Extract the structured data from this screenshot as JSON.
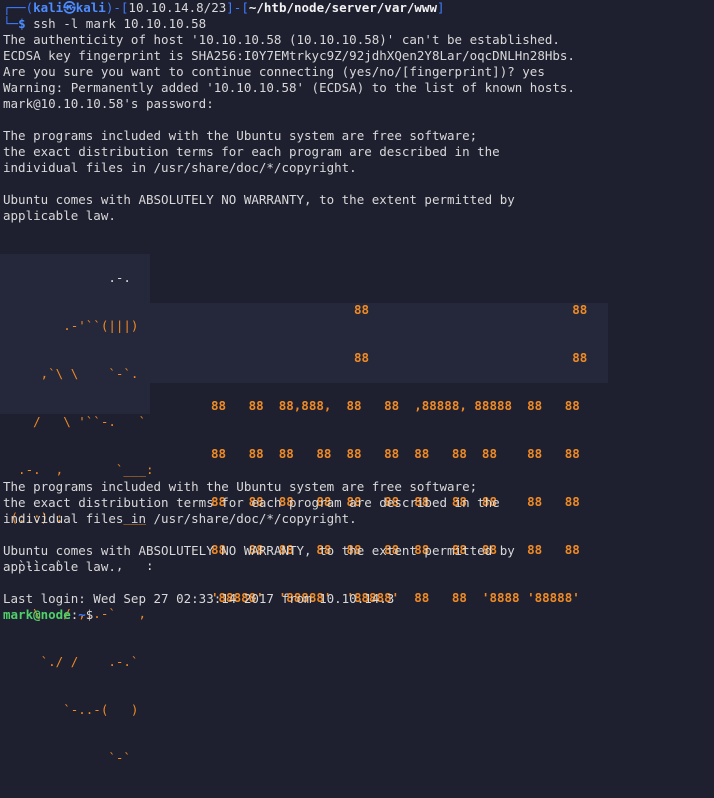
{
  "prompt": {
    "corner_top": "┌──(",
    "user": "kali",
    "at": "㉿",
    "host": "kali",
    "mid": ")-[",
    "ip": "10.10.14.8/23",
    "sep": "]-[",
    "path": "~/htb/node/server/var/www",
    "end": "]",
    "corner_bottom": "└─",
    "dollar": "$",
    "command": " ssh -l mark 10.10.10.58"
  },
  "ssh_output": [
    "The authenticity of host '10.10.10.58 (10.10.10.58)' can't be established.",
    "ECDSA key fingerprint is SHA256:I0Y7EMtrkyc9Z/92jdhXQen2Y8Lar/oqcDNLHn28Hbs.",
    "Are you sure you want to continue connecting (yes/no/[fingerprint])? yes",
    "Warning: Permanently added '10.10.10.58' (ECDSA) to the list of known hosts.",
    "mark@10.10.10.58's password:"
  ],
  "motd1": [
    "The programs included with the Ubuntu system are free software;",
    "the exact distribution terms for each program are described in the",
    "individual files in /usr/share/doc/*/copyright."
  ],
  "warranty1": [
    "Ubuntu comes with ABSOLUTELY NO WARRANTY, to the extent permitted by",
    "applicable law."
  ],
  "ascii_logo": [
    "              .-.",
    "        .-'``(|||)",
    "     ,`\\ \\    `-`.",
    "    /   \\ '``-.   `",
    "  .-.  ,       `___:",
    " (:::) :        ___",
    "  `-`  `       ,   :",
    "    \\   / ,..-`   ,",
    "     `./ /    .-.`",
    "        `-..-(   )",
    "              `-`"
  ],
  "ascii_banner": [
    "                   88                           88",
    "                   88                           88",
    "88   88  88,888,  88   88  ,88888, 88888  88   88",
    "88   88  88   88  88   88  88   88  88    88   88",
    "88   88  88   88  88   88  88   88  88    88   88",
    "88   88  88   88  88   88  88   88  88    88   88",
    "'88888'  '88888'  '88888'  88   88  '8888 '88888'"
  ],
  "motd2": [
    "The programs included with the Ubuntu system are free software;",
    "the exact distribution terms for each program are described in the",
    "individual files in /usr/share/doc/*/copyright."
  ],
  "warranty2": [
    "Ubuntu comes with ABSOLUTELY NO WARRANTY, to the extent permitted by",
    "applicable law."
  ],
  "last_login": "Last login: Wed Sep 27 02:33:14 2017 from 10.10.14.3",
  "final_prompt": {
    "user_host": "mark@node",
    "colon": ":",
    "path": "~",
    "dollar": "$"
  },
  "colors": {
    "background": "#1e2030",
    "prompt_blue": "#3f7cff",
    "banner_orange": "#f08a24",
    "user_green": "#4fd06a"
  }
}
